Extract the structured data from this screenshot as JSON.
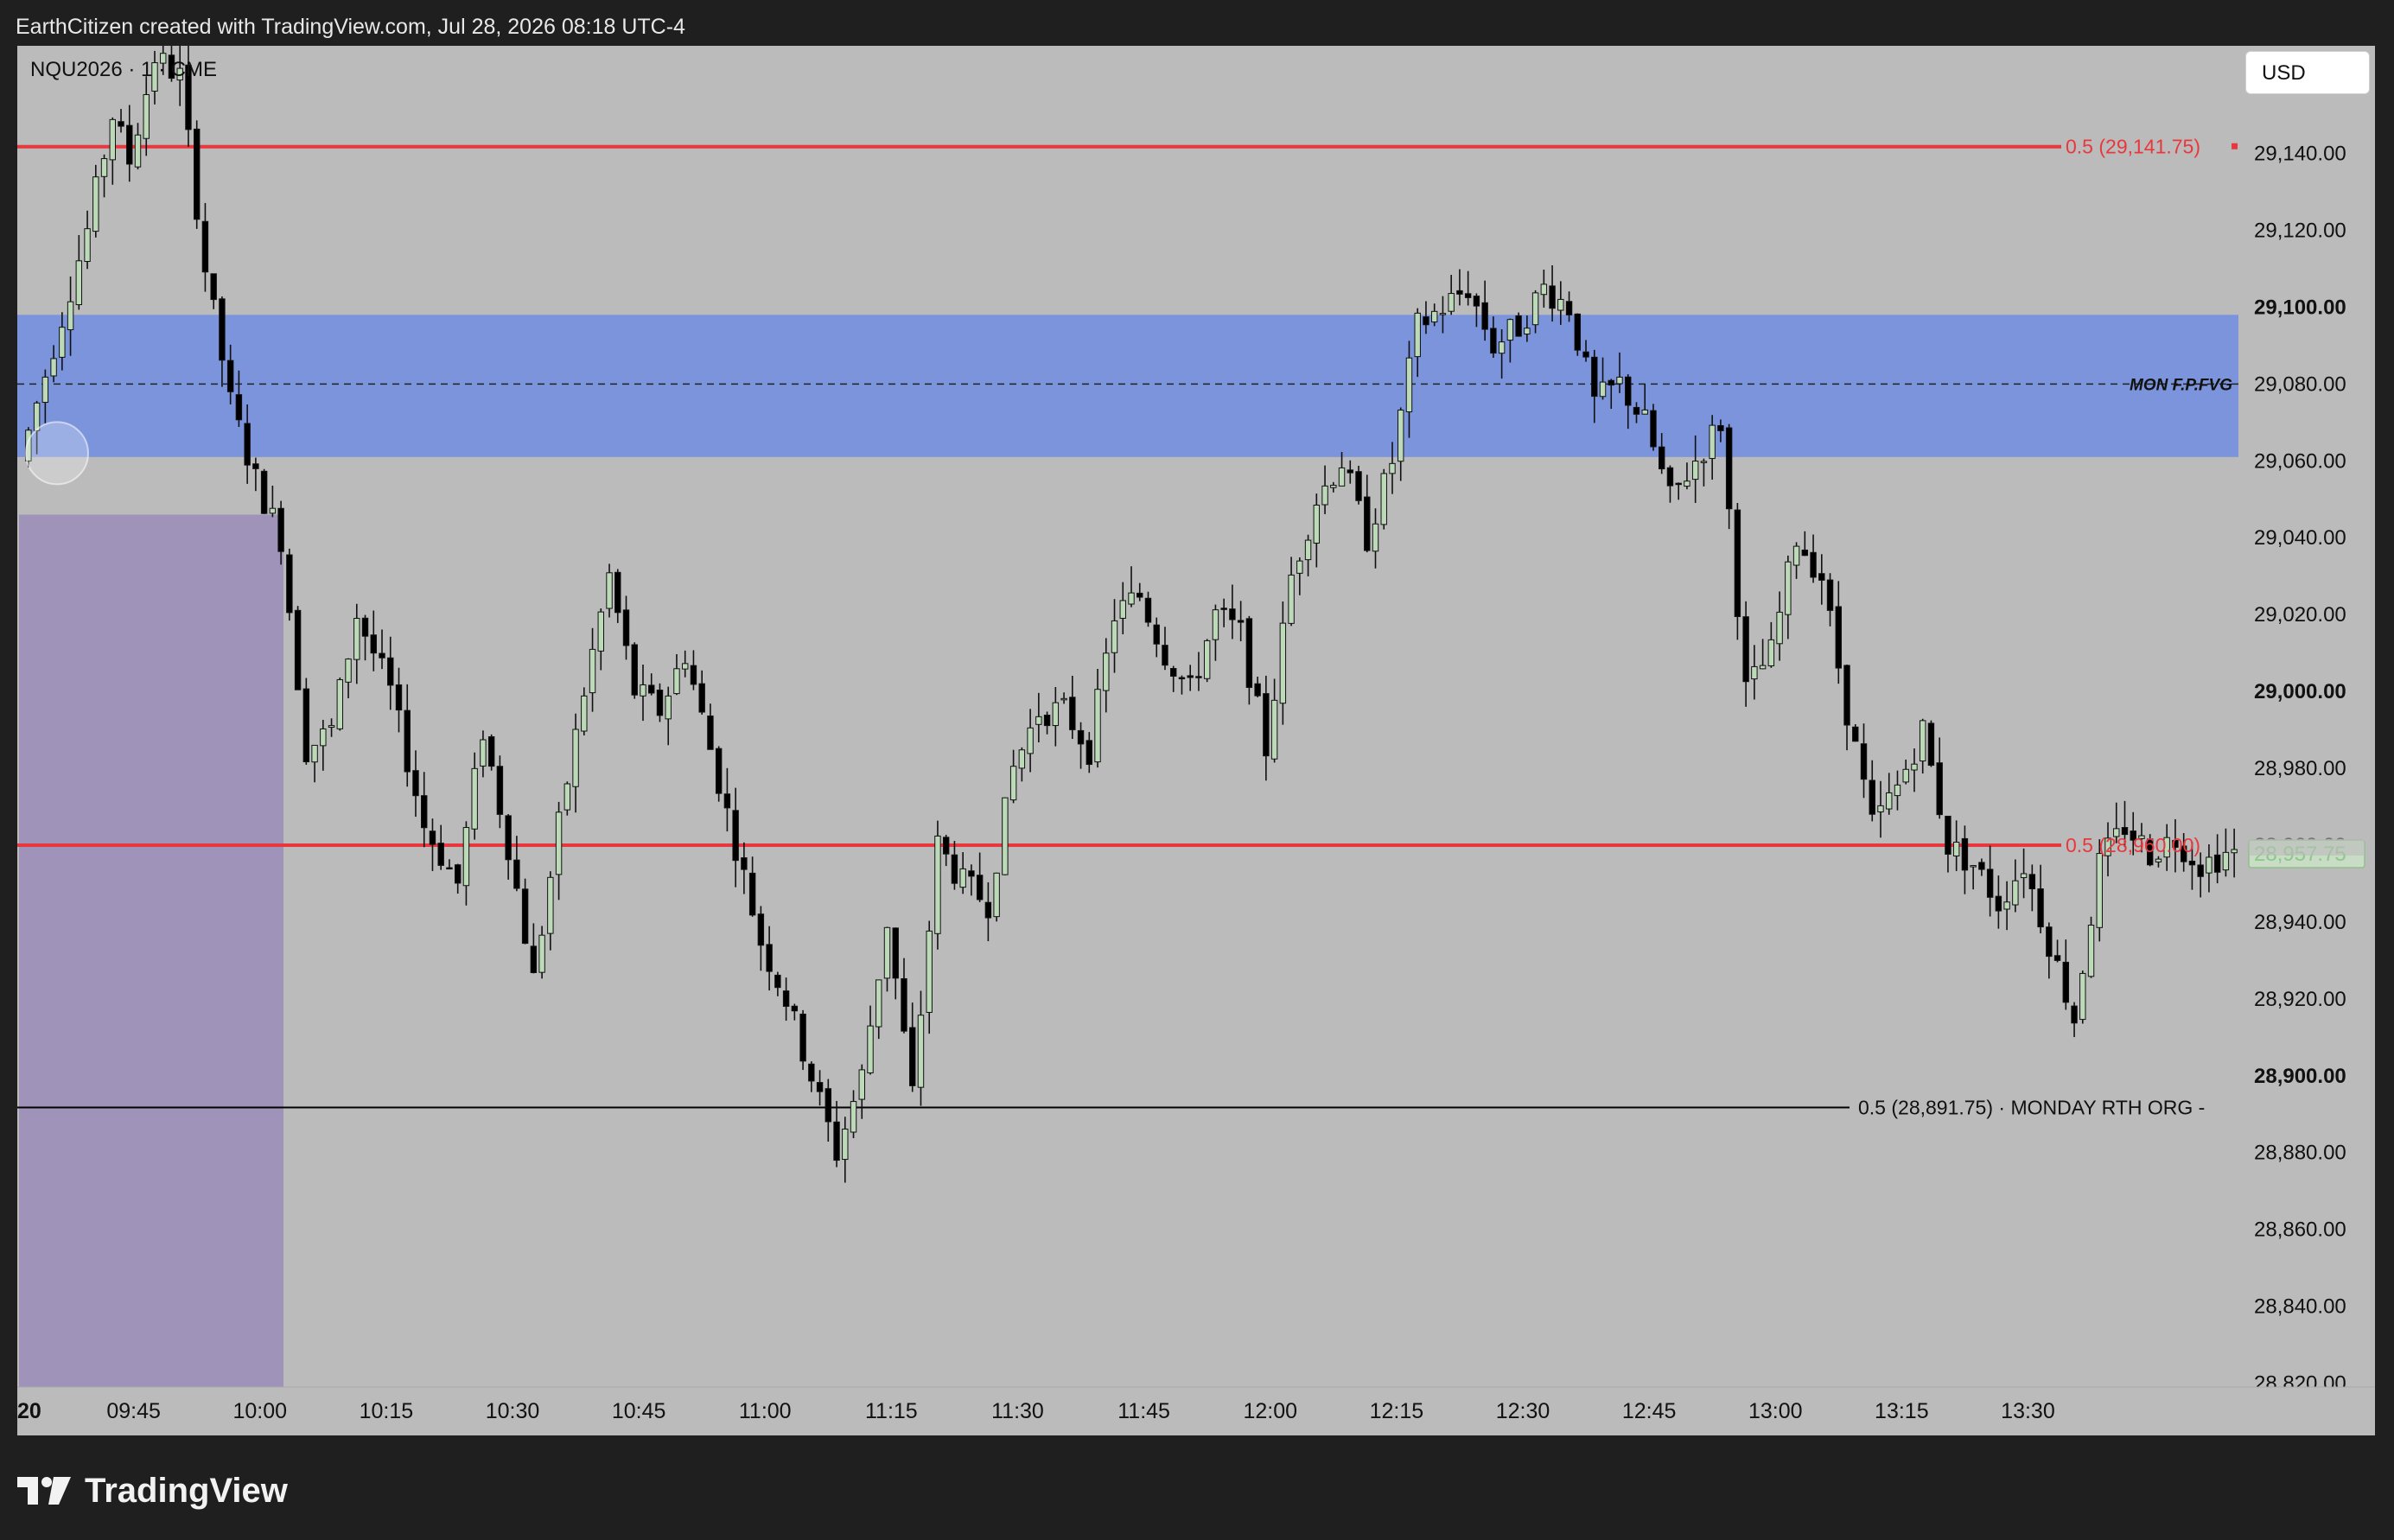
{
  "header": {
    "attribution": "EarthCitizen created with TradingView.com, Jul 28, 2026 08:18 UTC-4"
  },
  "symbol": {
    "ticker": "NQU2026",
    "interval": "1",
    "exchange": "CME",
    "display": "NQU2026 · 1 · CME"
  },
  "currency_button": "USD",
  "footer": {
    "brand": "TradingView"
  },
  "colors": {
    "chart_bg": "#bbbbbb",
    "up_candle": "#bcd9b8",
    "down_candle": "#000000",
    "red_level": "#e8383d",
    "fvg_zone": "#7b94dc",
    "purple_zone": "#a093b9",
    "dark_bg": "#1f1f1f"
  },
  "chart_data": {
    "type": "candlestick",
    "timeframe": "1 minute",
    "x_ticks": [
      "20",
      "09:45",
      "10:00",
      "10:15",
      "10:30",
      "10:45",
      "11:00",
      "11:15",
      "11:30",
      "11:45",
      "12:00",
      "12:15",
      "12:30",
      "12:45",
      "13:00",
      "13:15",
      "13:30"
    ],
    "x_bold_ticks": [
      "20"
    ],
    "y_ticks": [
      "29,140.00",
      "29,120.00",
      "29,100.00",
      "29,080.00",
      "29,060.00",
      "29,040.00",
      "29,020.00",
      "29,000.00",
      "28,980.00",
      "28,960.00",
      "28,940.00",
      "28,920.00",
      "28,900.00",
      "28,880.00",
      "28,860.00",
      "28,840.00",
      "28,820.00"
    ],
    "y_tick_values": [
      29140,
      29120,
      29100,
      29080,
      29060,
      29040,
      29020,
      29000,
      28980,
      28960,
      28940,
      28920,
      28900,
      28880,
      28860,
      28840,
      28820
    ],
    "y_bold_ticks": [
      "29,100.00",
      "29,000.00",
      "28,900.00"
    ],
    "ylim": [
      28819,
      29168
    ],
    "time_range": [
      "09:32",
      "13:32"
    ],
    "last_price_label": "28,957.75",
    "last_price": 28957.75,
    "levels": [
      {
        "label": "0.5 (29,141.75)",
        "price": 29141.75,
        "color": "#e8383d",
        "style": "solid"
      },
      {
        "label": "0.5 (28,960.00)",
        "price": 28960.0,
        "color": "#e8383d",
        "style": "solid"
      },
      {
        "label": "0.5 (28,891.75) · MONDAY RTH ORG -",
        "price": 28891.75,
        "color": "#000000",
        "style": "solid"
      }
    ],
    "zones": [
      {
        "label": "MON F.P.FVG",
        "top": 29098,
        "bottom": 29061,
        "mid": 29080,
        "color": "#7b94dc"
      },
      {
        "label": "",
        "top": 29046,
        "bottom": 28819,
        "time_start": "09:32",
        "time_end": "09:59",
        "color": "#a093b9"
      }
    ],
    "anchors": [
      {
        "t": 0,
        "p": 29060
      },
      {
        "t": 4,
        "p": 29090
      },
      {
        "t": 8,
        "p": 29120
      },
      {
        "t": 11,
        "p": 29150
      },
      {
        "t": 13,
        "p": 29138
      },
      {
        "t": 16,
        "p": 29165
      },
      {
        "t": 19,
        "p": 29160
      },
      {
        "t": 22,
        "p": 29110
      },
      {
        "t": 25,
        "p": 29075
      },
      {
        "t": 28,
        "p": 29055
      },
      {
        "t": 31,
        "p": 29040
      },
      {
        "t": 34,
        "p": 28985
      },
      {
        "t": 37,
        "p": 28990
      },
      {
        "t": 40,
        "p": 29020
      },
      {
        "t": 44,
        "p": 29000
      },
      {
        "t": 48,
        "p": 28965
      },
      {
        "t": 52,
        "p": 28950
      },
      {
        "t": 55,
        "p": 28990
      },
      {
        "t": 58,
        "p": 28960
      },
      {
        "t": 61,
        "p": 28925
      },
      {
        "t": 64,
        "p": 28965
      },
      {
        "t": 67,
        "p": 29000
      },
      {
        "t": 70,
        "p": 29030
      },
      {
        "t": 73,
        "p": 29000
      },
      {
        "t": 76,
        "p": 28995
      },
      {
        "t": 79,
        "p": 29010
      },
      {
        "t": 82,
        "p": 28985
      },
      {
        "t": 85,
        "p": 28960
      },
      {
        "t": 88,
        "p": 28935
      },
      {
        "t": 91,
        "p": 28920
      },
      {
        "t": 94,
        "p": 28900
      },
      {
        "t": 97,
        "p": 28880
      },
      {
        "t": 100,
        "p": 28900
      },
      {
        "t": 103,
        "p": 28940
      },
      {
        "t": 106,
        "p": 28895
      },
      {
        "t": 109,
        "p": 28960
      },
      {
        "t": 112,
        "p": 28950
      },
      {
        "t": 115,
        "p": 28945
      },
      {
        "t": 118,
        "p": 28980
      },
      {
        "t": 121,
        "p": 28995
      },
      {
        "t": 124,
        "p": 28995
      },
      {
        "t": 127,
        "p": 28985
      },
      {
        "t": 130,
        "p": 29020
      },
      {
        "t": 133,
        "p": 29025
      },
      {
        "t": 136,
        "p": 29010
      },
      {
        "t": 139,
        "p": 29000
      },
      {
        "t": 142,
        "p": 29020
      },
      {
        "t": 145,
        "p": 29015
      },
      {
        "t": 148,
        "p": 28985
      },
      {
        "t": 151,
        "p": 29030
      },
      {
        "t": 154,
        "p": 29050
      },
      {
        "t": 157,
        "p": 29060
      },
      {
        "t": 160,
        "p": 29040
      },
      {
        "t": 163,
        "p": 29060
      },
      {
        "t": 166,
        "p": 29095
      },
      {
        "t": 169,
        "p": 29100
      },
      {
        "t": 172,
        "p": 29105
      },
      {
        "t": 175,
        "p": 29090
      },
      {
        "t": 178,
        "p": 29095
      },
      {
        "t": 181,
        "p": 29105
      },
      {
        "t": 184,
        "p": 29100
      },
      {
        "t": 187,
        "p": 29075
      },
      {
        "t": 190,
        "p": 29080
      },
      {
        "t": 193,
        "p": 29070
      },
      {
        "t": 196,
        "p": 29050
      },
      {
        "t": 199,
        "p": 29060
      },
      {
        "t": 202,
        "p": 29070
      },
      {
        "t": 205,
        "p": 29000
      },
      {
        "t": 208,
        "p": 29010
      },
      {
        "t": 211,
        "p": 29040
      },
      {
        "t": 214,
        "p": 29030
      },
      {
        "t": 217,
        "p": 28995
      },
      {
        "t": 220,
        "p": 28965
      },
      {
        "t": 223,
        "p": 28975
      },
      {
        "t": 226,
        "p": 28990
      },
      {
        "t": 229,
        "p": 28960
      },
      {
        "t": 232,
        "p": 28955
      },
      {
        "t": 235,
        "p": 28945
      },
      {
        "t": 238,
        "p": 28955
      },
      {
        "t": 241,
        "p": 28935
      },
      {
        "t": 244,
        "p": 28915
      },
      {
        "t": 247,
        "p": 28955
      },
      {
        "t": 250,
        "p": 28965
      },
      {
        "t": 253,
        "p": 28958
      },
      {
        "t": 256,
        "p": 28962
      },
      {
        "t": 259,
        "p": 28955
      },
      {
        "t": 262,
        "p": 28957.75
      }
    ]
  }
}
